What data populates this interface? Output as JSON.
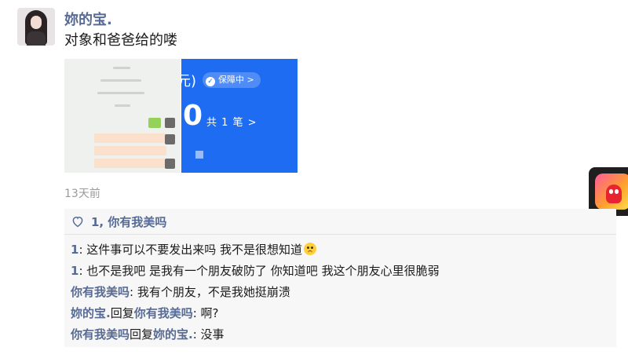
{
  "post": {
    "username": "妳的宝.",
    "text": "对象和爸爸给的喽",
    "time": "13天前"
  },
  "screenshot_right": {
    "unit_fragment": "元)",
    "badge_label": "保障中 >",
    "amount_fragment": "0",
    "count_label": "共 1 笔 >"
  },
  "likes": {
    "label": "1, 你有我美吗"
  },
  "comments": [
    {
      "author": "1",
      "text": ": 这件事可以不要发出来吗 我不是很想知道"
    },
    {
      "author": "1",
      "text": ": 也不是我吧 是我有一个朋友破防了 你知道吧 我这个朋友心里很脆弱"
    },
    {
      "author": "你有我美吗",
      "text": ": 我有个朋友，不是我她挺崩溃"
    },
    {
      "author": "妳的宝.",
      "reply_word": "回复",
      "reply_to": "你有我美吗",
      "text": ": 啊?"
    },
    {
      "author": "你有我美吗",
      "reply_word": "回复",
      "reply_to": "妳的宝.",
      "text": ": 没事"
    }
  ],
  "colors": {
    "name_blue": "#576b95",
    "screenshot_blue": "#1e6cf2",
    "comment_bg": "#f7f7f7",
    "time_gray": "#9a9a9a"
  },
  "icons": [
    "avatar",
    "heart-icon",
    "shield-check-icon",
    "worried-face-emoji",
    "floating-app-icon"
  ]
}
